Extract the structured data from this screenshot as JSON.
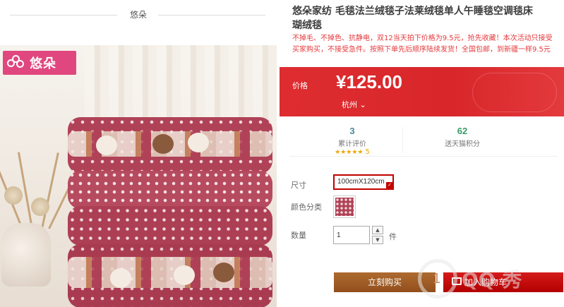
{
  "shop": {
    "name": "悠朵",
    "logo_text": "悠朵"
  },
  "product": {
    "title_line1": "悠朵家纺 毛毯法兰绒毯子法莱绒毯单人午睡毯空调毯床",
    "title_line2": "瑚绒毯",
    "desc_line1": "不掉毛、不掉色、抗静电，双12当天拍下价格为9.5元，抢先收藏！本次活动只接受",
    "desc_line2": "买家购买，不接受急件。按照下单先后顺序陆续发货！全国包邮，到新疆一样9.5元"
  },
  "price": {
    "label": "价格",
    "value": "¥125.00",
    "location": "杭州"
  },
  "stats": {
    "reviews_count": "3",
    "reviews_label": "累计评价",
    "rating_stars": "★★★★★",
    "rating_value": "5",
    "points_count": "62",
    "points_label": "送天猫积分"
  },
  "options": {
    "size_label": "尺寸",
    "size_value": "100cmX120cm",
    "color_label": "颜色分类",
    "qty_label": "数量",
    "qty_value": "1",
    "qty_unit": "件",
    "qty_up": "▲",
    "qty_down": "▼"
  },
  "buttons": {
    "buy_now": "立刻购买",
    "add_to_cart": "加入购物车"
  },
  "misc": {
    "fragment": "1",
    "watermark": "QQ 秀"
  },
  "colors": {
    "price_bg": "#e02f32",
    "buy_btn": "#a05a22",
    "cart_btn": "#c40000",
    "accent": "#e4393c"
  }
}
